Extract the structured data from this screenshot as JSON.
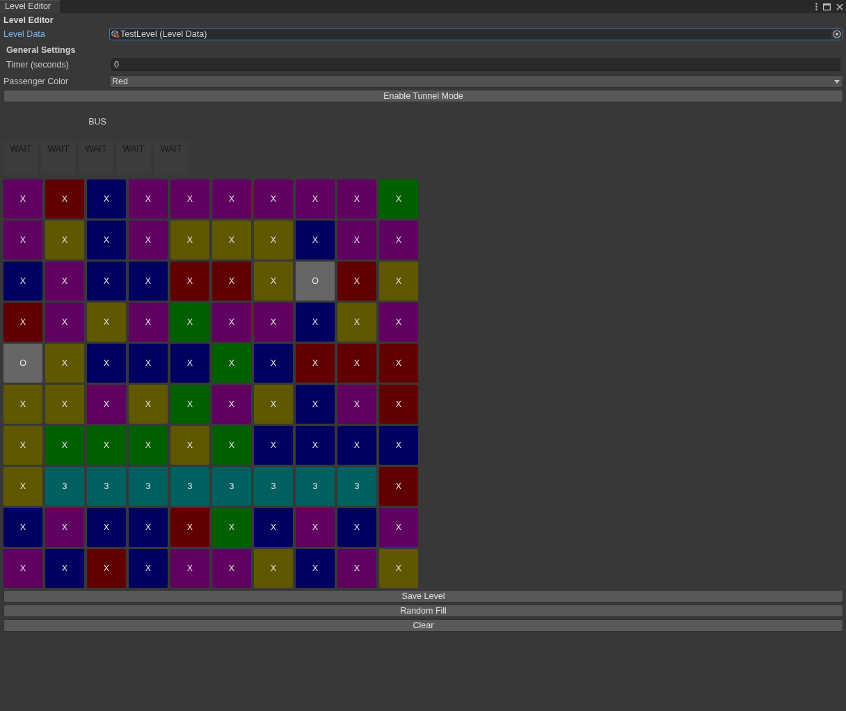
{
  "window": {
    "tabs": [
      {
        "label": "Level Editor",
        "selected": true
      }
    ]
  },
  "editor": {
    "title": "Level Editor",
    "level_data": {
      "label": "Level Data",
      "value": "TestLevel (Level Data)",
      "focused": true
    }
  },
  "general_settings": {
    "title": "General Settings",
    "timer": {
      "label": "Timer (seconds)",
      "value": "0"
    },
    "passenger_color": {
      "label": "Passenger Color",
      "value": "Red"
    }
  },
  "tunnel_button": "Enable Tunnel Mode",
  "bus": {
    "label": "BUS",
    "slots": [
      "WAIT",
      "WAIT",
      "WAIT",
      "WAIT",
      "WAIT"
    ]
  },
  "grid": {
    "rows": [
      [
        {
          "label": "X",
          "color": "#600060"
        },
        {
          "label": "X",
          "color": "#600000"
        },
        {
          "label": "X",
          "color": "#000060"
        },
        {
          "label": "X",
          "color": "#600060"
        },
        {
          "label": "X",
          "color": "#600060"
        },
        {
          "label": "X",
          "color": "#600060"
        },
        {
          "label": "X",
          "color": "#600060"
        },
        {
          "label": "X",
          "color": "#600060"
        },
        {
          "label": "X",
          "color": "#600060"
        },
        {
          "label": "X",
          "color": "#006000"
        }
      ],
      [
        {
          "label": "X",
          "color": "#600060"
        },
        {
          "label": "X",
          "color": "#5f5800"
        },
        {
          "label": "X",
          "color": "#000060"
        },
        {
          "label": "X",
          "color": "#600060"
        },
        {
          "label": "X",
          "color": "#5f5800"
        },
        {
          "label": "X",
          "color": "#5f5800"
        },
        {
          "label": "X",
          "color": "#5f5800"
        },
        {
          "label": "X",
          "color": "#000060"
        },
        {
          "label": "X",
          "color": "#600060"
        },
        {
          "label": "X",
          "color": "#600060"
        }
      ],
      [
        {
          "label": "X",
          "color": "#000060"
        },
        {
          "label": "X",
          "color": "#600060"
        },
        {
          "label": "X",
          "color": "#000060"
        },
        {
          "label": "X",
          "color": "#000060"
        },
        {
          "label": "X",
          "color": "#600000"
        },
        {
          "label": "X",
          "color": "#600000"
        },
        {
          "label": "X",
          "color": "#5f5800"
        },
        {
          "label": "O",
          "color": "#666666"
        },
        {
          "label": "X",
          "color": "#600000"
        },
        {
          "label": "X",
          "color": "#5f5800"
        }
      ],
      [
        {
          "label": "X",
          "color": "#600000"
        },
        {
          "label": "X",
          "color": "#600060"
        },
        {
          "label": "X",
          "color": "#5f5800"
        },
        {
          "label": "X",
          "color": "#600060"
        },
        {
          "label": "X",
          "color": "#006000"
        },
        {
          "label": "X",
          "color": "#600060"
        },
        {
          "label": "X",
          "color": "#600060"
        },
        {
          "label": "X",
          "color": "#000060"
        },
        {
          "label": "X",
          "color": "#5f5800"
        },
        {
          "label": "X",
          "color": "#600060"
        }
      ],
      [
        {
          "label": "O",
          "color": "#666666"
        },
        {
          "label": "X",
          "color": "#5f5800"
        },
        {
          "label": "X",
          "color": "#000060"
        },
        {
          "label": "X",
          "color": "#000060"
        },
        {
          "label": "X",
          "color": "#000060"
        },
        {
          "label": "X",
          "color": "#006000"
        },
        {
          "label": "X",
          "color": "#000060"
        },
        {
          "label": "X",
          "color": "#600000"
        },
        {
          "label": "X",
          "color": "#600000"
        },
        {
          "label": "X",
          "color": "#600000"
        }
      ],
      [
        {
          "label": "X",
          "color": "#5f5800"
        },
        {
          "label": "X",
          "color": "#5f5800"
        },
        {
          "label": "X",
          "color": "#600060"
        },
        {
          "label": "X",
          "color": "#5f5800"
        },
        {
          "label": "X",
          "color": "#006000"
        },
        {
          "label": "X",
          "color": "#600060"
        },
        {
          "label": "X",
          "color": "#5f5800"
        },
        {
          "label": "X",
          "color": "#000060"
        },
        {
          "label": "X",
          "color": "#600060"
        },
        {
          "label": "X",
          "color": "#600000"
        }
      ],
      [
        {
          "label": "X",
          "color": "#5f5800"
        },
        {
          "label": "X",
          "color": "#006000"
        },
        {
          "label": "X",
          "color": "#006000"
        },
        {
          "label": "X",
          "color": "#006000"
        },
        {
          "label": "X",
          "color": "#5f5800"
        },
        {
          "label": "X",
          "color": "#006000"
        },
        {
          "label": "X",
          "color": "#000060"
        },
        {
          "label": "X",
          "color": "#000060"
        },
        {
          "label": "X",
          "color": "#000060"
        },
        {
          "label": "X",
          "color": "#000060"
        }
      ],
      [
        {
          "label": "X",
          "color": "#5f5800"
        },
        {
          "label": "3",
          "color": "#005f5f"
        },
        {
          "label": "3",
          "color": "#005f5f"
        },
        {
          "label": "3",
          "color": "#005f5f"
        },
        {
          "label": "3",
          "color": "#005f5f"
        },
        {
          "label": "3",
          "color": "#005f5f"
        },
        {
          "label": "3",
          "color": "#005f5f"
        },
        {
          "label": "3",
          "color": "#005f5f"
        },
        {
          "label": "3",
          "color": "#005f5f"
        },
        {
          "label": "X",
          "color": "#600000"
        }
      ],
      [
        {
          "label": "X",
          "color": "#000060"
        },
        {
          "label": "X",
          "color": "#600060"
        },
        {
          "label": "X",
          "color": "#000060"
        },
        {
          "label": "X",
          "color": "#000060"
        },
        {
          "label": "X",
          "color": "#600000"
        },
        {
          "label": "X",
          "color": "#006000"
        },
        {
          "label": "X",
          "color": "#000060"
        },
        {
          "label": "X",
          "color": "#600060"
        },
        {
          "label": "X",
          "color": "#000060"
        },
        {
          "label": "X",
          "color": "#600060"
        }
      ],
      [
        {
          "label": "X",
          "color": "#600060"
        },
        {
          "label": "X",
          "color": "#000060"
        },
        {
          "label": "X",
          "color": "#600000"
        },
        {
          "label": "X",
          "color": "#000060"
        },
        {
          "label": "X",
          "color": "#600060"
        },
        {
          "label": "X",
          "color": "#600060"
        },
        {
          "label": "X",
          "color": "#5f5800"
        },
        {
          "label": "X",
          "color": "#000060"
        },
        {
          "label": "X",
          "color": "#600060"
        },
        {
          "label": "X",
          "color": "#5f5800"
        }
      ]
    ]
  },
  "actions": [
    "Save Level",
    "Random Fill",
    "Clear"
  ]
}
